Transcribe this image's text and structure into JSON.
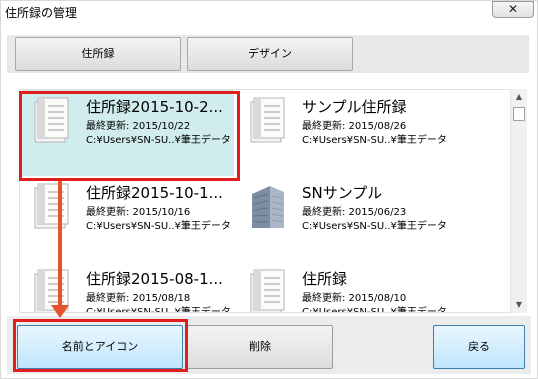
{
  "window": {
    "title": "住所録の管理",
    "close_label": "✕"
  },
  "tabs": [
    {
      "label": "住所録"
    },
    {
      "label": "デザイン"
    }
  ],
  "address_books": [
    {
      "name": "住所録2015-10-2...",
      "updated": "最終更新: 2015/10/22",
      "path": "C:¥Users¥SN-SU..¥筆王データ",
      "icon": "document-icon",
      "selected": true
    },
    {
      "name": "サンプル住所録",
      "updated": "最終更新: 2015/08/26",
      "path": "C:¥Users¥SN-SU..¥筆王データ",
      "icon": "document-icon",
      "selected": false
    },
    {
      "name": "住所録2015-10-1...",
      "updated": "最終更新: 2015/10/16",
      "path": "C:¥Users¥SN-SU..¥筆王データ",
      "icon": "document-icon",
      "selected": false
    },
    {
      "name": "SNサンプル",
      "updated": "最終更新: 2015/06/23",
      "path": "C:¥Users¥SN-SU..¥筆王データ",
      "icon": "building-icon",
      "selected": false
    },
    {
      "name": "住所録2015-08-1...",
      "updated": "最終更新: 2015/08/18",
      "path": "C:¥Users¥SN-SU..¥筆王データ",
      "icon": "document-icon",
      "selected": false
    },
    {
      "name": "住所録",
      "updated": "最終更新: 2015/08/10",
      "path": "C:¥Users¥SN-SU..¥筆王データ",
      "icon": "document-icon",
      "selected": false
    }
  ],
  "scrollbar": {
    "up_arrow": "▲",
    "down_arrow": "▼"
  },
  "buttons": {
    "rename_icon": "名前とアイコン",
    "delete": "削除",
    "back": "戻る"
  },
  "colors": {
    "selection": "#d1eced",
    "annotation_red": "#e01e1e",
    "annotation_arrow": "#e8522a",
    "primary_button": "#bee6fd"
  }
}
